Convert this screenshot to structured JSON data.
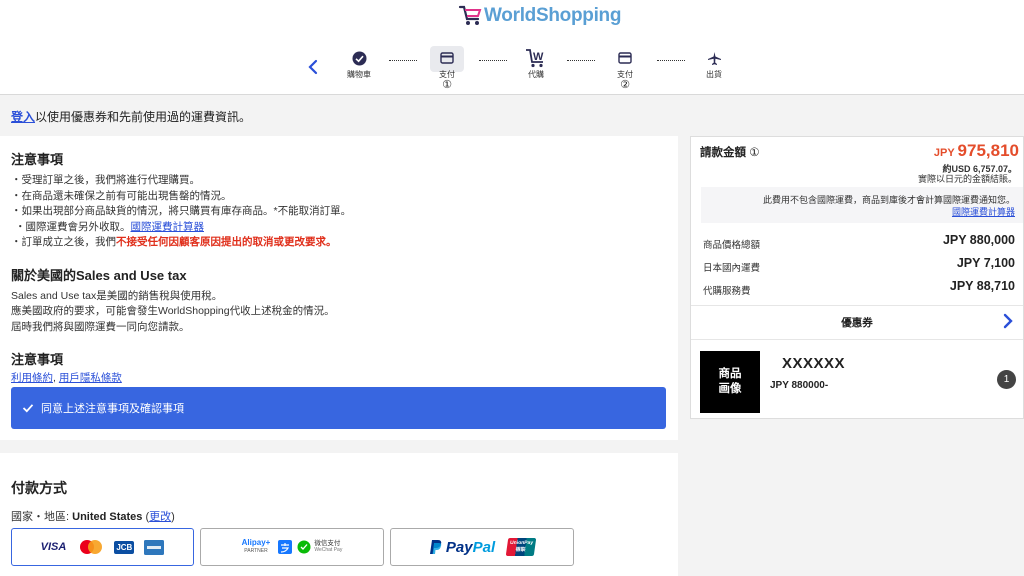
{
  "header": {
    "brand": "WorldShopping",
    "steps": [
      {
        "label": "購物車",
        "num": ""
      },
      {
        "label": "支付",
        "num": "①"
      },
      {
        "label": "代購",
        "num": ""
      },
      {
        "label": "支付",
        "num": "②"
      },
      {
        "label": "出貨",
        "num": ""
      }
    ]
  },
  "login": {
    "link": "登入",
    "text": "以使用優惠券和先前使用過的運費資訊。"
  },
  "notice": {
    "title1": "注意事項",
    "lines": [
      "・受理訂單之後，我們將進行代理購買。",
      "・在商品還未確保之前有可能出現售罄的情況。",
      "・如果出現部分商品缺貨的情況，將只購買有庫存商品。*不能取消訂單。",
      "・國際運費會另外收取。"
    ],
    "calc_link": "國際運費計算器",
    "last_prefix": "・訂單成立之後，我們",
    "last_red": "不接受任何因顧客原因提出的取消或更改要求。",
    "title2": "關於美國的Sales and Use tax",
    "tax_lines": [
      "Sales and Use tax是美國的銷售稅與使用稅。",
      "應美國政府的要求，可能會發生WorldShopping代收上述稅金的情況。",
      "屆時我們將與國際運費一同向您請款。"
    ],
    "title3": "注意事項",
    "terms_link": "利用條約",
    "separator": ",",
    "privacy_link": "用戶隱私條款",
    "agree_label": "同意上述注意事項及確認事項"
  },
  "payment": {
    "title": "付款方式",
    "country_label": "國家・地區:",
    "country_value": "United States",
    "change_link": "更改",
    "visa": "VISA",
    "jcb": "JCB",
    "alipay": "Alipay+",
    "alipay_partner": "PARTNER",
    "wechat": "微信支付",
    "wechat_en": "WeChat Pay",
    "paypal_pay": "Pay",
    "paypal_pal": "Pal",
    "unionpay": "UnionPay",
    "unionpay_cn": "银联"
  },
  "summary": {
    "title": "請款金額",
    "title_num": "①",
    "currency": "JPY",
    "amount": "975,810",
    "usd_line": "約USD 6,757.07。",
    "usd_note": "實際以日元的金額結賬。",
    "note": "此費用不包含國際運費，商品到庫後才會計算國際運費通知您。",
    "note_link": "國際運費計算器",
    "rows": [
      {
        "label": "商品價格總額",
        "value": "JPY 880,000"
      },
      {
        "label": "日本國內運費",
        "value": "JPY 7,100"
      },
      {
        "label": "代購服務費",
        "value": "JPY 88,710"
      }
    ],
    "coupon": "優惠券",
    "item": {
      "thumb_line1": "商品",
      "thumb_line2": "画像",
      "name": "XXXXXX",
      "price": "JPY 880000-",
      "qty": "1"
    }
  },
  "colors": {
    "accent": "#3866e0",
    "price": "#e44d2b",
    "brand": "#5a9fd4"
  }
}
